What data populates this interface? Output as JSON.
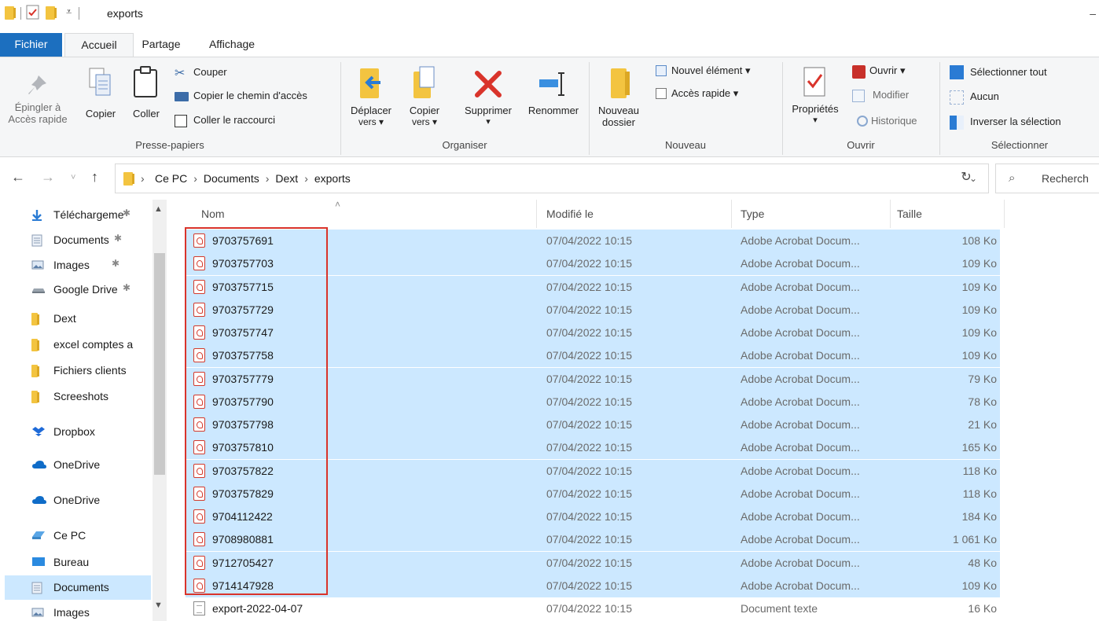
{
  "window": {
    "title": "exports"
  },
  "ribbon_tabs": [
    "Fichier",
    "Accueil",
    "Partage",
    "Affichage"
  ],
  "ribbon": {
    "clipboard": {
      "pin_label": [
        "Épingler à",
        "Accès rapide"
      ],
      "copy_label": "Copier",
      "paste_label": "Coller",
      "cut_label": "Couper",
      "copy_path_label": "Copier le chemin d'accès",
      "paste_shortcut_label": "Coller le raccourci",
      "group_label": "Presse-papiers"
    },
    "organize": {
      "move_label": [
        "Déplacer",
        "vers ▾"
      ],
      "copyto_label": [
        "Copier",
        "vers ▾"
      ],
      "delete_label": "Supprimer",
      "delete_arrow": "▾",
      "rename_label": "Renommer",
      "group_label": "Organiser"
    },
    "new": {
      "new_folder_label": [
        "Nouveau",
        "dossier"
      ],
      "new_item_label": "Nouvel élément ▾",
      "easy_access_label": "Accès rapide ▾",
      "group_label": "Nouveau"
    },
    "open": {
      "properties_label": "Propriétés",
      "properties_arrow": "▾",
      "open_label": "Ouvrir ▾",
      "edit_label": "Modifier",
      "history_label": "Historique",
      "group_label": "Ouvrir"
    },
    "select": {
      "select_all_label": "Sélectionner tout",
      "select_none_label": "Aucun",
      "invert_label": "Inverser la sélection",
      "group_label": "Sélectionner"
    }
  },
  "address": {
    "breadcrumbs": [
      "Ce PC",
      "Documents",
      "Dext",
      "exports"
    ],
    "search_placeholder": "Recherch"
  },
  "nav_pane": [
    {
      "label": "Téléchargeme",
      "icon": "download-icon",
      "pinned": true
    },
    {
      "label": "Documents",
      "icon": "documents-icon",
      "pinned": true
    },
    {
      "label": "Images",
      "icon": "images-icon",
      "pinned": true
    },
    {
      "label": "Google Drive",
      "icon": "drive-icon",
      "pinned": true
    },
    {
      "label": "Dext",
      "icon": "folder-icon",
      "pinned": false
    },
    {
      "label": "excel comptes a",
      "icon": "folder-icon",
      "pinned": false
    },
    {
      "label": "Fichiers clients",
      "icon": "folder-icon",
      "pinned": false
    },
    {
      "label": "Screeshots",
      "icon": "folder-icon",
      "pinned": false
    },
    {
      "label": "Dropbox",
      "icon": "dropbox-icon",
      "pinned": false
    },
    {
      "label": "OneDrive",
      "icon": "cloud-icon",
      "pinned": false
    },
    {
      "label": "OneDrive",
      "icon": "cloud-icon",
      "pinned": false
    },
    {
      "label": "Ce PC",
      "icon": "pc-icon",
      "pinned": false
    },
    {
      "label": "Bureau",
      "icon": "desktop-icon",
      "pinned": false
    },
    {
      "label": "Documents",
      "icon": "documents-icon",
      "pinned": false,
      "selected": true
    },
    {
      "label": "Images",
      "icon": "images-icon",
      "pinned": false
    }
  ],
  "columns": [
    "Nom",
    "Modifié le",
    "Type",
    "Taille"
  ],
  "files": [
    {
      "name": "9703757691",
      "date": "07/04/2022 10:15",
      "type": "Adobe Acrobat Docum...",
      "size": "108 Ko",
      "kind": "pdf",
      "selected": true
    },
    {
      "name": "9703757703",
      "date": "07/04/2022 10:15",
      "type": "Adobe Acrobat Docum...",
      "size": "109 Ko",
      "kind": "pdf",
      "selected": true
    },
    {
      "name": "9703757715",
      "date": "07/04/2022 10:15",
      "type": "Adobe Acrobat Docum...",
      "size": "109 Ko",
      "kind": "pdf",
      "selected": true
    },
    {
      "name": "9703757729",
      "date": "07/04/2022 10:15",
      "type": "Adobe Acrobat Docum...",
      "size": "109 Ko",
      "kind": "pdf",
      "selected": true
    },
    {
      "name": "9703757747",
      "date": "07/04/2022 10:15",
      "type": "Adobe Acrobat Docum...",
      "size": "109 Ko",
      "kind": "pdf",
      "selected": true
    },
    {
      "name": "9703757758",
      "date": "07/04/2022 10:15",
      "type": "Adobe Acrobat Docum...",
      "size": "109 Ko",
      "kind": "pdf",
      "selected": true
    },
    {
      "name": "9703757779",
      "date": "07/04/2022 10:15",
      "type": "Adobe Acrobat Docum...",
      "size": "79 Ko",
      "kind": "pdf",
      "selected": true
    },
    {
      "name": "9703757790",
      "date": "07/04/2022 10:15",
      "type": "Adobe Acrobat Docum...",
      "size": "78 Ko",
      "kind": "pdf",
      "selected": true
    },
    {
      "name": "9703757798",
      "date": "07/04/2022 10:15",
      "type": "Adobe Acrobat Docum...",
      "size": "21 Ko",
      "kind": "pdf",
      "selected": true
    },
    {
      "name": "9703757810",
      "date": "07/04/2022 10:15",
      "type": "Adobe Acrobat Docum...",
      "size": "165 Ko",
      "kind": "pdf",
      "selected": true
    },
    {
      "name": "9703757822",
      "date": "07/04/2022 10:15",
      "type": "Adobe Acrobat Docum...",
      "size": "118 Ko",
      "kind": "pdf",
      "selected": true
    },
    {
      "name": "9703757829",
      "date": "07/04/2022 10:15",
      "type": "Adobe Acrobat Docum...",
      "size": "118 Ko",
      "kind": "pdf",
      "selected": true
    },
    {
      "name": "9704112422",
      "date": "07/04/2022 10:15",
      "type": "Adobe Acrobat Docum...",
      "size": "184 Ko",
      "kind": "pdf",
      "selected": true
    },
    {
      "name": "9708980881",
      "date": "07/04/2022 10:15",
      "type": "Adobe Acrobat Docum...",
      "size": "1 061 Ko",
      "kind": "pdf",
      "selected": true
    },
    {
      "name": "9712705427",
      "date": "07/04/2022 10:15",
      "type": "Adobe Acrobat Docum...",
      "size": "48 Ko",
      "kind": "pdf",
      "selected": true
    },
    {
      "name": "9714147928",
      "date": "07/04/2022 10:15",
      "type": "Adobe Acrobat Docum...",
      "size": "109 Ko",
      "kind": "pdf",
      "selected": true
    },
    {
      "name": "export-2022-04-07",
      "date": "07/04/2022 10:15",
      "type": "Document texte",
      "size": "16 Ko",
      "kind": "txt",
      "selected": false
    }
  ],
  "colors": {
    "accent": "#1c6fbf",
    "selection": "#cce8ff",
    "highlight_box": "#d9342b",
    "folder": "#f3c440",
    "delete_red": "#d9342b"
  }
}
